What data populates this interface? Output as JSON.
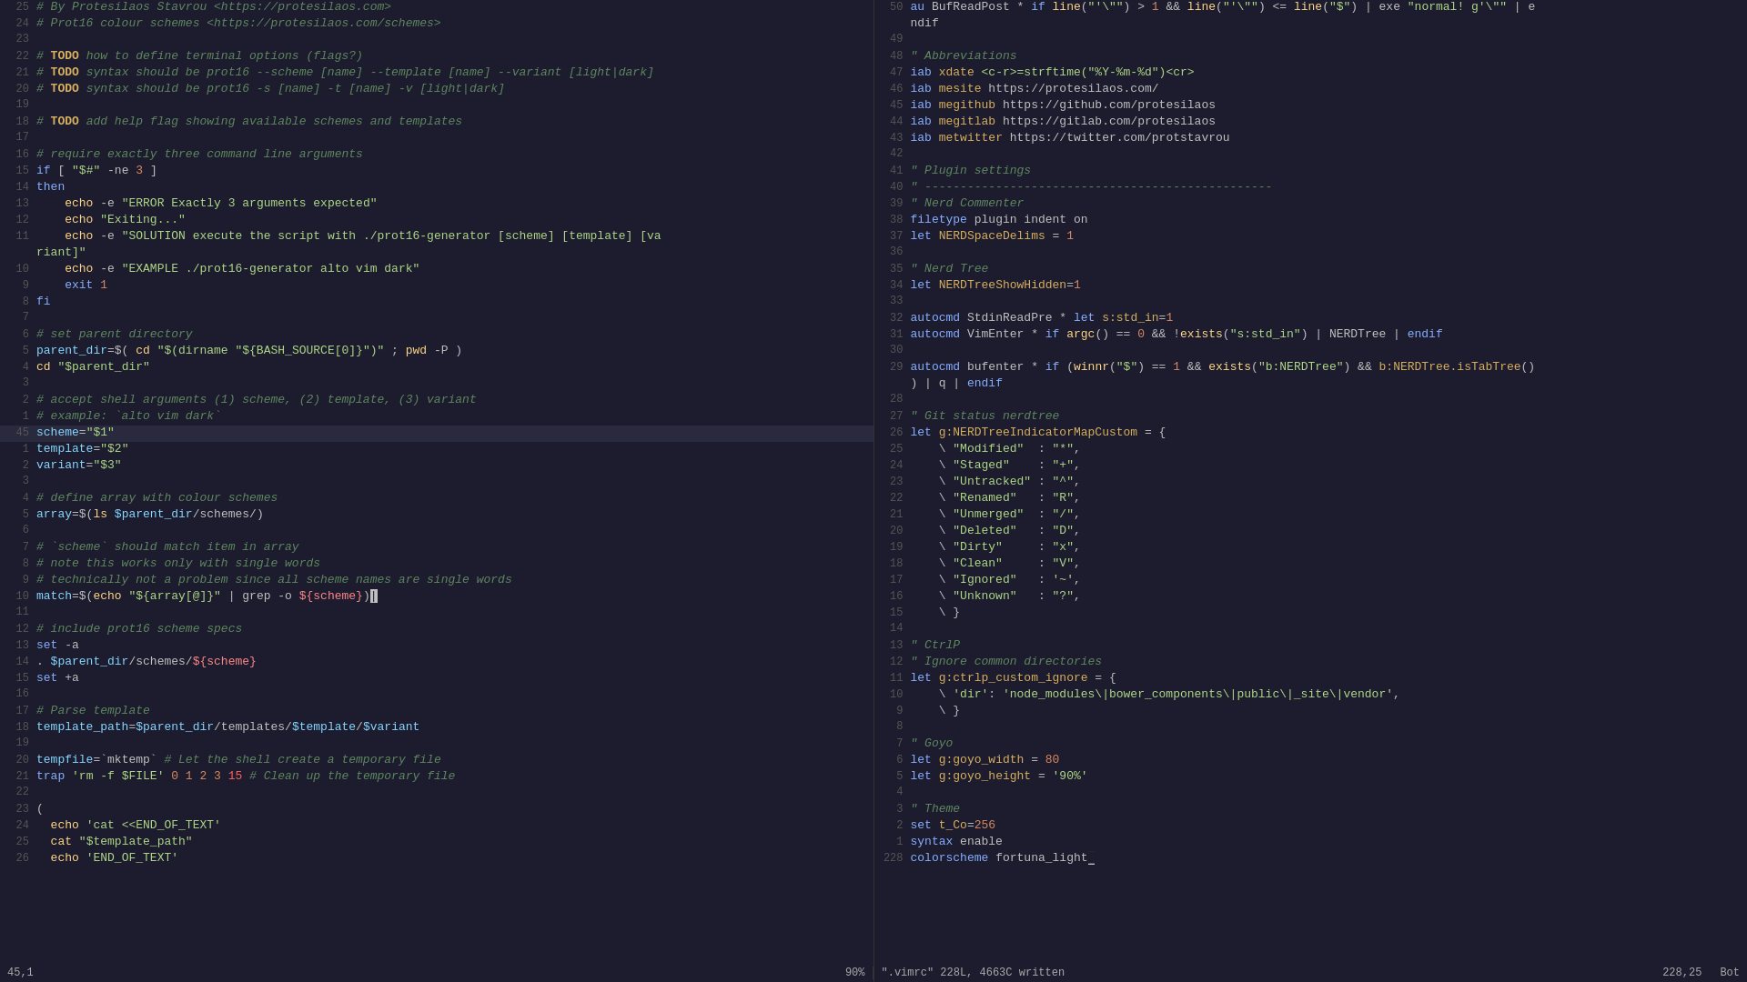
{
  "editor": {
    "title": "vim editor",
    "left_pane": {
      "lines": [
        {
          "num": "25",
          "content": "# By Protesilaos Stavrou <https://protesilaos.com>",
          "type": "comment"
        },
        {
          "num": "24",
          "content": "# Prot16 colour schemes <https://protesilaos.com/schemes>",
          "type": "comment"
        },
        {
          "num": "23",
          "content": "",
          "type": "normal"
        },
        {
          "num": "22",
          "content": "# TODO how to define terminal options (flags?)",
          "type": "todo-comment"
        },
        {
          "num": "21",
          "content": "# TODO syntax should be prot16 --scheme [name] --template [name] --variant [light|dark]",
          "type": "todo-comment"
        },
        {
          "num": "20",
          "content": "# TODO syntax should be prot16 -s [name] -t [name] -v [light|dark]",
          "type": "todo-comment"
        },
        {
          "num": "19",
          "content": "",
          "type": "normal"
        },
        {
          "num": "18",
          "content": "# TODO add help flag showing available schemes and templates",
          "type": "todo-comment"
        },
        {
          "num": "17",
          "content": "",
          "type": "normal"
        },
        {
          "num": "16",
          "content": "# require exactly three command line arguments",
          "type": "comment"
        },
        {
          "num": "15",
          "content": "if [ \"$#\" -ne 3 ]",
          "type": "code"
        },
        {
          "num": "14",
          "content": "then",
          "type": "keyword"
        },
        {
          "num": "13",
          "content": "    echo -e \"ERROR Exactly 3 arguments expected\"",
          "type": "code"
        },
        {
          "num": "12",
          "content": "    echo \"Exiting...\"",
          "type": "code"
        },
        {
          "num": "11",
          "content": "    echo -e \"SOLUTION execute the script with ./prot16-generator [scheme] [template] [va",
          "type": "code"
        },
        {
          "num": "",
          "content": "riant]\"",
          "type": "code-cont"
        },
        {
          "num": "10",
          "content": "    echo -e \"EXAMPLE ./prot16-generator alto vim dark\"",
          "type": "code"
        },
        {
          "num": "9",
          "content": "    exit 1",
          "type": "code"
        },
        {
          "num": "8",
          "content": "fi",
          "type": "keyword"
        },
        {
          "num": "7",
          "content": "",
          "type": "normal"
        },
        {
          "num": "6",
          "content": "# set parent directory",
          "type": "comment"
        },
        {
          "num": "5",
          "content": "parent_dir=$( cd \"$(dirname \"${BASH_SOURCE[0]}\")\" ; pwd -P )",
          "type": "code"
        },
        {
          "num": "4",
          "content": "cd \"$parent_dir\"",
          "type": "code"
        },
        {
          "num": "3",
          "content": "",
          "type": "normal"
        },
        {
          "num": "2",
          "content": "# accept shell arguments (1) scheme, (2) template, (3) variant",
          "type": "comment"
        },
        {
          "num": "1",
          "content": "# example: `alto vim dark`",
          "type": "comment"
        },
        {
          "num": "45",
          "content": "scheme=\"$1\"",
          "type": "code",
          "highlighted": true
        },
        {
          "num": "1",
          "content": "template=\"$2\"",
          "type": "code"
        },
        {
          "num": "2",
          "content": "variant=\"$3\"",
          "type": "code"
        },
        {
          "num": "3",
          "content": "",
          "type": "normal"
        },
        {
          "num": "4",
          "content": "# define array with colour schemes",
          "type": "comment"
        },
        {
          "num": "5",
          "content": "array=$(ls $parent_dir/schemes/)",
          "type": "code"
        },
        {
          "num": "6",
          "content": "",
          "type": "normal"
        },
        {
          "num": "7",
          "content": "# `scheme` should match item in array",
          "type": "comment"
        },
        {
          "num": "8",
          "content": "# note this works only with single words",
          "type": "comment"
        },
        {
          "num": "9",
          "content": "# technically not a problem since all scheme names are single words",
          "type": "comment"
        },
        {
          "num": "10",
          "content": "match=$(echo \"${array[@]}\" | grep -o ${scheme})",
          "type": "code",
          "cursor": true
        },
        {
          "num": "11",
          "content": "",
          "type": "normal"
        },
        {
          "num": "12",
          "content": "# include prot16 scheme specs",
          "type": "comment"
        },
        {
          "num": "13",
          "content": "set -a",
          "type": "code"
        },
        {
          "num": "14",
          "content": ". $parent_dir/schemes/${scheme}",
          "type": "code"
        },
        {
          "num": "15",
          "content": "set +a",
          "type": "code"
        },
        {
          "num": "16",
          "content": "",
          "type": "normal"
        },
        {
          "num": "17",
          "content": "# Parse template",
          "type": "comment"
        },
        {
          "num": "18",
          "content": "template_path=$parent_dir/templates/$template/$variant",
          "type": "code"
        },
        {
          "num": "19",
          "content": "",
          "type": "normal"
        },
        {
          "num": "20",
          "content": "tempfile=`mktemp` # Let the shell create a temporary file",
          "type": "code"
        },
        {
          "num": "21",
          "content": "trap 'rm -f $FILE' 0 1 2 3 15 # Clean up the temporary file",
          "type": "code"
        },
        {
          "num": "22",
          "content": "",
          "type": "normal"
        },
        {
          "num": "23",
          "content": "(",
          "type": "code"
        },
        {
          "num": "24",
          "content": "  echo 'cat <<END_OF_TEXT'",
          "type": "code"
        },
        {
          "num": "25",
          "content": "  cat \"$template_path\"",
          "type": "code"
        },
        {
          "num": "26",
          "content": "  echo 'END_OF_TEXT'",
          "type": "code"
        }
      ],
      "status": "45,1",
      "percent": "90%"
    },
    "right_pane": {
      "lines": [
        {
          "num": "50",
          "content": "au BufReadPost * if line(\"'\\\"\") > 1 && line(\"'\\\"\") <= line(\"$\") | exe \"normal! g'\\\"\" | e",
          "type": "code"
        },
        {
          "num": "",
          "content": "ndif",
          "type": "code-cont"
        },
        {
          "num": "49",
          "content": "",
          "type": "normal"
        },
        {
          "num": "48",
          "content": "\" Abbreviations",
          "type": "comment"
        },
        {
          "num": "47",
          "content": "iab xdate <c-r>=strftime(\"%Y-%m-%d\")<cr>",
          "type": "code"
        },
        {
          "num": "46",
          "content": "iab mesite https://protesilaos.com/",
          "type": "code"
        },
        {
          "num": "45",
          "content": "iab megithub https://github.com/protesilaos",
          "type": "code"
        },
        {
          "num": "44",
          "content": "iab megitlab https://gitlab.com/protesilaos",
          "type": "code"
        },
        {
          "num": "43",
          "content": "iab metwitter https://twitter.com/protstavrou",
          "type": "code"
        },
        {
          "num": "42",
          "content": "",
          "type": "normal"
        },
        {
          "num": "41",
          "content": "\" Plugin settings",
          "type": "comment"
        },
        {
          "num": "40",
          "content": "\" -------------------------------------------------",
          "type": "comment"
        },
        {
          "num": "39",
          "content": "\" Nerd Commenter",
          "type": "comment"
        },
        {
          "num": "38",
          "content": "filetype plugin indent on",
          "type": "code"
        },
        {
          "num": "37",
          "content": "let NERDSpaceDelims = 1",
          "type": "code"
        },
        {
          "num": "36",
          "content": "",
          "type": "normal"
        },
        {
          "num": "35",
          "content": "\" Nerd Tree",
          "type": "comment"
        },
        {
          "num": "34",
          "content": "let NERDTreeShowHidden=1",
          "type": "code"
        },
        {
          "num": "33",
          "content": "",
          "type": "normal"
        },
        {
          "num": "32",
          "content": "autocmd StdinReadPre * let s:std_in=1",
          "type": "code"
        },
        {
          "num": "31",
          "content": "autocmd VimEnter * if argc() == 0 && !exists(\"s:std_in\") | NERDTree | endif",
          "type": "code"
        },
        {
          "num": "30",
          "content": "",
          "type": "normal"
        },
        {
          "num": "29",
          "content": "autocmd bufenter * if (winnr(\"$\") == 1 && exists(\"b:NERDTree\") && b:NERDTree.isTabTree()",
          "type": "code"
        },
        {
          "num": "",
          "content": ") | q | endif",
          "type": "code-cont"
        },
        {
          "num": "28",
          "content": "",
          "type": "normal"
        },
        {
          "num": "27",
          "content": "\" Git status nerdtree",
          "type": "comment"
        },
        {
          "num": "26",
          "content": "let g:NERDTreeIndicatorMapCustom = {",
          "type": "code"
        },
        {
          "num": "25",
          "content": "    \\ \"Modified\"  : \"*\",",
          "type": "code"
        },
        {
          "num": "24",
          "content": "    \\ \"Staged\"    : \"+\",",
          "type": "code"
        },
        {
          "num": "23",
          "content": "    \\ \"Untracked\" : \"^\",",
          "type": "code"
        },
        {
          "num": "22",
          "content": "    \\ \"Renamed\"   : \"R\",",
          "type": "code"
        },
        {
          "num": "21",
          "content": "    \\ \"Unmerged\"  : \"/\",",
          "type": "code"
        },
        {
          "num": "20",
          "content": "    \\ \"Deleted\"   : \"D\",",
          "type": "code"
        },
        {
          "num": "19",
          "content": "    \\ \"Dirty\"     : \"x\",",
          "type": "code"
        },
        {
          "num": "18",
          "content": "    \\ \"Clean\"     : \"V\",",
          "type": "code"
        },
        {
          "num": "17",
          "content": "    \\ \"Ignored\"   : '~',",
          "type": "code"
        },
        {
          "num": "16",
          "content": "    \\ \"Unknown\"   : \"?\",",
          "type": "code"
        },
        {
          "num": "15",
          "content": "    \\ }",
          "type": "code"
        },
        {
          "num": "14",
          "content": "",
          "type": "normal"
        },
        {
          "num": "13",
          "content": "\" CtrlP",
          "type": "comment"
        },
        {
          "num": "12",
          "content": "\" Ignore common directories",
          "type": "comment"
        },
        {
          "num": "11",
          "content": "let g:ctrlp_custom_ignore = {",
          "type": "code"
        },
        {
          "num": "10",
          "content": "    \\ 'dir': 'node_modules\\|bower_components\\|public\\|_site\\|vendor',",
          "type": "code"
        },
        {
          "num": "9",
          "content": "    \\ }",
          "type": "code"
        },
        {
          "num": "8",
          "content": "",
          "type": "normal"
        },
        {
          "num": "7",
          "content": "\" Goyo",
          "type": "comment"
        },
        {
          "num": "6",
          "content": "let g:goyo_width = 80",
          "type": "code"
        },
        {
          "num": "5",
          "content": "let g:goyo_height = '90%'",
          "type": "code"
        },
        {
          "num": "4",
          "content": "",
          "type": "normal"
        },
        {
          "num": "3",
          "content": "\" Theme",
          "type": "comment"
        },
        {
          "num": "2",
          "content": "set t_Co=256",
          "type": "code"
        },
        {
          "num": "1",
          "content": "syntax enable",
          "type": "code"
        },
        {
          "num": "228",
          "content": "colorscheme fortuna_light",
          "type": "code",
          "cursor": true
        }
      ],
      "status": "228,25",
      "filename": "\".vimrc\" 228L, 4663C written",
      "bot": "Bot"
    }
  }
}
